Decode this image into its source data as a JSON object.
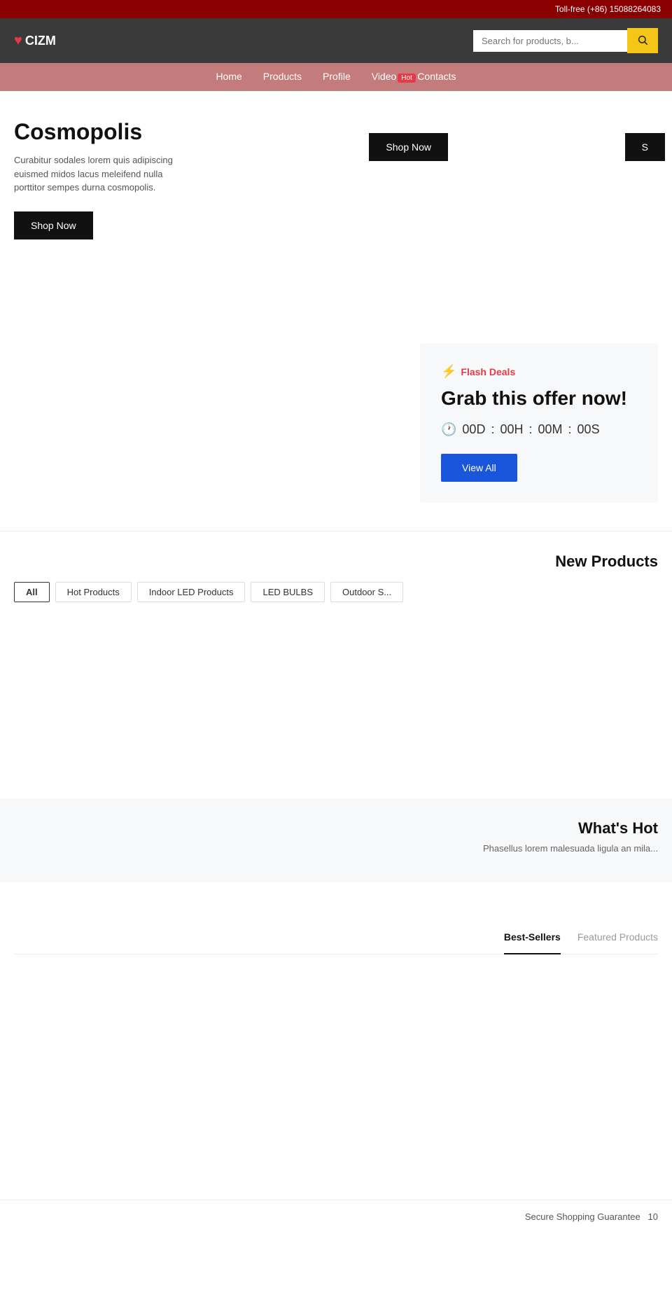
{
  "topbar": {
    "phone": "Toll-free (+86) 15088264083"
  },
  "header": {
    "logo_text": "CIZM",
    "logo_icon": "♥",
    "search_placeholder": "Search for products, b..."
  },
  "nav": {
    "badge": "Hot",
    "items": [
      {
        "label": "Home",
        "id": "home"
      },
      {
        "label": "Products",
        "id": "products"
      },
      {
        "label": "Profile",
        "id": "profile"
      },
      {
        "label": "Video",
        "id": "video"
      },
      {
        "label": "Contacts",
        "id": "contacts"
      }
    ]
  },
  "hero": {
    "title": "Cosmopolis",
    "description": "Curabitur sodales lorem quis adipiscing euismed midos lacus meleifend nulla porttitor sempes durna cosmopolis.",
    "shop_now_1": "Shop Now",
    "shop_now_2": "Shop Now",
    "shop_now_3": "S"
  },
  "flash_deals": {
    "label": "Flash Deals",
    "title": "Grab this offer now!",
    "timer_days": "00D",
    "timer_hours": "00H",
    "timer_mins": "00M",
    "timer_secs": "00S",
    "timer_sep": ":",
    "view_all": "View All"
  },
  "new_products": {
    "section_title": "New Products",
    "filters": [
      {
        "label": "All",
        "active": true
      },
      {
        "label": "Hot Products",
        "active": false
      },
      {
        "label": "Indoor LED Products",
        "active": false
      },
      {
        "label": "LED BULBS",
        "active": false
      },
      {
        "label": "Outdoor S...",
        "active": false
      }
    ]
  },
  "whats_hot": {
    "title": "What's Hot",
    "description": "Phasellus lorem malesuada ligula an mila..."
  },
  "best_sellers": {
    "tabs": [
      {
        "label": "Best-Sellers",
        "active": true
      },
      {
        "label": "Featured Products",
        "active": false
      }
    ]
  },
  "footer": {
    "secure_shopping": "Secure Shopping Guarantee",
    "icon_num": "10"
  }
}
